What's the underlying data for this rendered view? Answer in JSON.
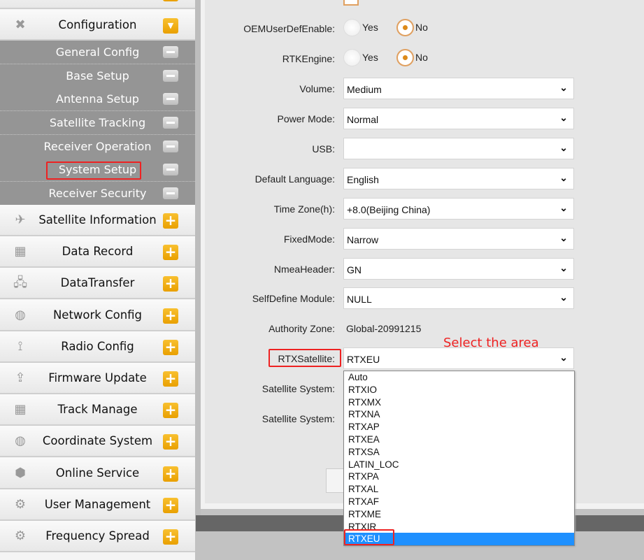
{
  "sidebar": {
    "configuration": {
      "label": "Configuration",
      "icon": "wrench-icon"
    },
    "sub_items": [
      {
        "label": "General Config"
      },
      {
        "label": "Base Setup"
      },
      {
        "label": "Antenna Setup"
      },
      {
        "label": "Satellite Tracking"
      },
      {
        "label": "Receiver Operation"
      },
      {
        "label": "System Setup",
        "highlighted": true
      },
      {
        "label": "Receiver Security"
      }
    ],
    "items": [
      {
        "label": "Satellite Information",
        "icon": "satellite-icon"
      },
      {
        "label": "Data Record",
        "icon": "calendar-chart-icon"
      },
      {
        "label": "DataTransfer",
        "icon": "network-icon"
      },
      {
        "label": "Network Config",
        "icon": "globe-icon"
      },
      {
        "label": "Radio Config",
        "icon": "radio-tower-icon"
      },
      {
        "label": "Firmware Update",
        "icon": "upload-icon"
      },
      {
        "label": "Track Manage",
        "icon": "calendar-chart-icon"
      },
      {
        "label": "Coordinate System",
        "icon": "globe-icon"
      },
      {
        "label": "Online Service",
        "icon": "cube-icon"
      },
      {
        "label": "User Management",
        "icon": "user-gear-icon"
      },
      {
        "label": "Frequency Spread",
        "icon": "user-gear-icon"
      }
    ]
  },
  "form": {
    "oem": {
      "label": "OEMUserDefEnable:",
      "yes": "Yes",
      "no": "No",
      "value": "No"
    },
    "rtk": {
      "label": "RTKEngine:",
      "yes": "Yes",
      "no": "No",
      "value": "No"
    },
    "volume": {
      "label": "Volume:",
      "value": "Medium"
    },
    "power": {
      "label": "Power Mode:",
      "value": "Normal"
    },
    "usb": {
      "label": "USB:",
      "value": ""
    },
    "language": {
      "label": "Default Language:",
      "value": "English"
    },
    "timezone": {
      "label": "Time Zone(h):",
      "value": "+8.0(Beijing China)"
    },
    "fixedmode": {
      "label": "FixedMode:",
      "value": "Narrow"
    },
    "nmea": {
      "label": "NmeaHeader:",
      "value": "GN"
    },
    "selfdefine": {
      "label": "SelfDefine Module:",
      "value": "NULL"
    },
    "authority": {
      "label": "Authority Zone:",
      "value": "Global-20991215"
    },
    "rtx": {
      "label": "RTXSatellite:",
      "value": "RTXEU"
    },
    "satsys1": {
      "label": "Satellite System:"
    },
    "satsys2": {
      "label": "Satellite System:"
    }
  },
  "dropdown": {
    "options": [
      "Auto",
      "RTXIO",
      "RTXMX",
      "RTXNA",
      "RTXAP",
      "RTXEA",
      "RTXSA",
      "LATIN_LOC",
      "RTXPA",
      "RTXAL",
      "RTXAF",
      "RTXME",
      "RTXIR",
      "RTXEU"
    ],
    "selected": "RTXEU"
  },
  "annotation": "Select the area",
  "colors": {
    "accent": "#e9a000",
    "highlight": "#1e90ff",
    "annotation": "#ee2222"
  }
}
